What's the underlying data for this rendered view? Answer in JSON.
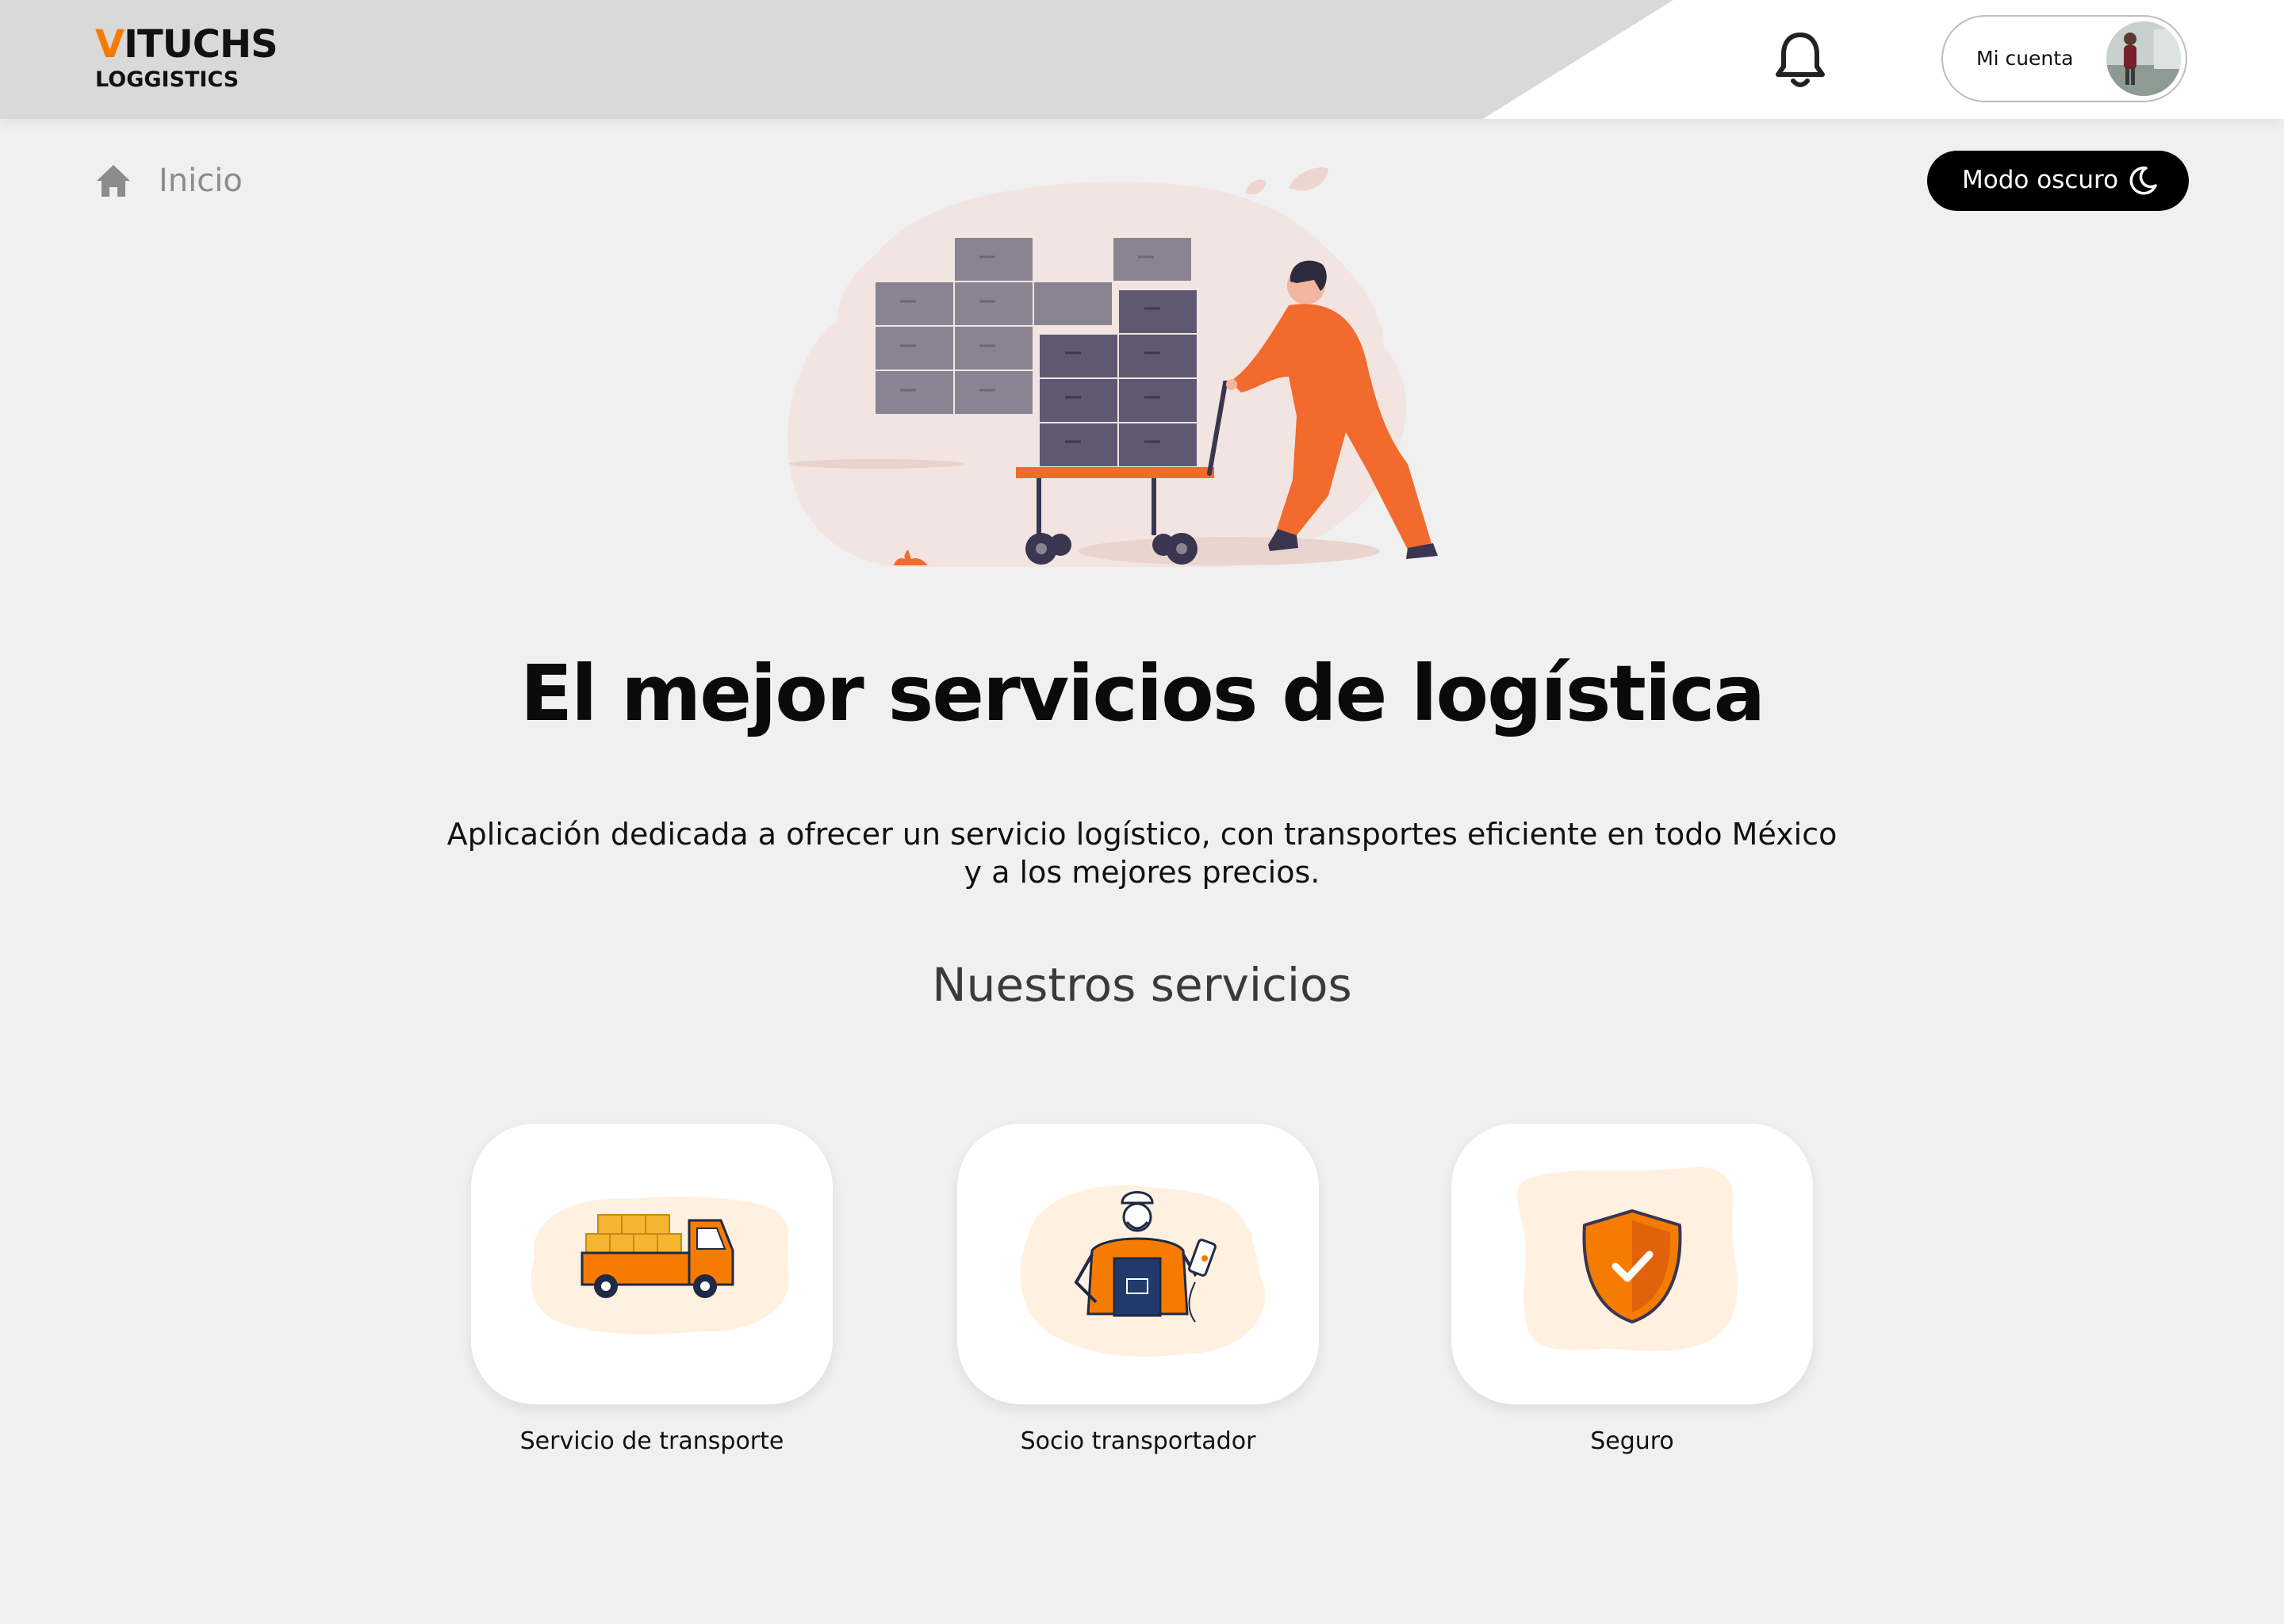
{
  "brand": {
    "logo_accent_letter": "V",
    "logo_rest": "ITUCHS",
    "logo_subtitle": "LOGGISTICS",
    "accent_color": "#f57c00"
  },
  "header": {
    "notification_icon": "bell-icon",
    "account_label": "Mi cuenta",
    "avatar_icon": "user-avatar"
  },
  "breadcrumb": {
    "icon": "home-icon",
    "label": "Inicio"
  },
  "theme_toggle": {
    "label": "Modo oscuro",
    "icon": "moon-icon"
  },
  "hero": {
    "illustration": "worker-pushing-boxes-illustration",
    "headline": "El mejor servicios de logística",
    "description": "Aplicación dedicada a ofrecer un servicio logístico, con transportes eficiente en todo México y a los mejores precios."
  },
  "services": {
    "title": "Nuestros servicios",
    "items": [
      {
        "label": "Servicio de transporte",
        "icon": "delivery-truck-icon"
      },
      {
        "label": "Socio transportador",
        "icon": "worker-icon"
      },
      {
        "label": "Seguro",
        "icon": "shield-check-icon"
      }
    ]
  },
  "colors": {
    "page_background": "#f0f0f0",
    "header_band": "#d9d9d9",
    "illustration_orange": "#f26a2e",
    "button_dark": "#000000"
  }
}
